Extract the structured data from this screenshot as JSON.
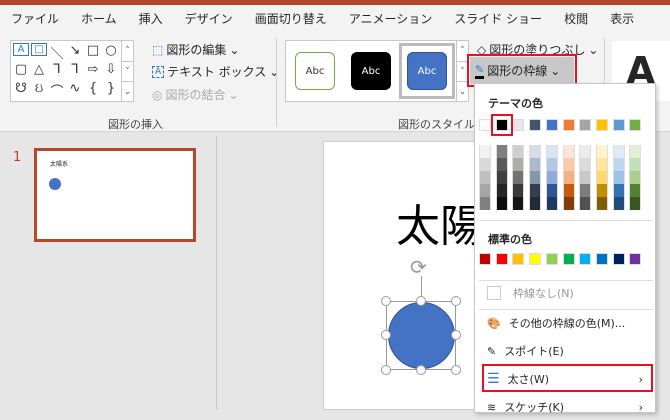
{
  "tabs": [
    "ファイル",
    "ホーム",
    "挿入",
    "デザイン",
    "画面切り替え",
    "アニメーション",
    "スライド ショー",
    "校閲",
    "表示"
  ],
  "ribbon": {
    "insert_shapes": {
      "edit_shape": "図形の編集",
      "text_box": "テキスト ボックス",
      "merge_shapes": "図形の結合",
      "group_label": "図形の挿入"
    },
    "shape_styles": {
      "styles": [
        "Abc",
        "Abc",
        "Abc"
      ],
      "fill": "図形の塗りつぶし",
      "outline": "図形の枠線",
      "group_label": "図形のスタイル"
    },
    "wordart_letter": "A"
  },
  "slides_pane": {
    "slide_number": "1",
    "thumb_title": "太陽系"
  },
  "slide": {
    "title_partial": "太陽"
  },
  "menu": {
    "theme_colors_label": "テーマの色",
    "theme_top": [
      "#ffffff",
      "#000000",
      "#e7e6e6",
      "#44546a",
      "#4472c4",
      "#ed7d31",
      "#a5a5a5",
      "#ffc000",
      "#5b9bd5",
      "#70ad47"
    ],
    "theme_shades": [
      [
        "#f2f2f2",
        "#d9d9d9",
        "#bfbfbf",
        "#a6a6a6",
        "#808080"
      ],
      [
        "#7f7f7f",
        "#595959",
        "#3f3f3f",
        "#262626",
        "#0d0d0d"
      ],
      [
        "#d0cece",
        "#aeabab",
        "#757171",
        "#3a3838",
        "#171616"
      ],
      [
        "#d6dce5",
        "#adb9ca",
        "#8497b0",
        "#333f50",
        "#222a35"
      ],
      [
        "#dae3f3",
        "#b4c7e7",
        "#8faadc",
        "#2f5597",
        "#203864"
      ],
      [
        "#fbe5d6",
        "#f8cbad",
        "#f4b183",
        "#c55a11",
        "#843c0c"
      ],
      [
        "#ededed",
        "#dbdbdb",
        "#c9c9c9",
        "#7c7c7c",
        "#525252"
      ],
      [
        "#fff2cc",
        "#ffe699",
        "#ffd966",
        "#bf9000",
        "#7f6000"
      ],
      [
        "#deebf7",
        "#bdd7ee",
        "#9dc3e6",
        "#2e75b6",
        "#1f4e79"
      ],
      [
        "#e2f0d9",
        "#c5e0b4",
        "#a9d18e",
        "#548235",
        "#385723"
      ]
    ],
    "standard_colors_label": "標準の色",
    "standard_colors": [
      "#c00000",
      "#ff0000",
      "#ffc000",
      "#ffff00",
      "#92d050",
      "#00b050",
      "#00b0f0",
      "#0070c0",
      "#002060",
      "#7030a0"
    ],
    "no_outline": "枠線なし(N)",
    "more_colors": "その他の枠線の色(M)...",
    "eyedropper": "スポイト(E)",
    "weight": "太さ(W)",
    "sketched": "スケッチ(K)",
    "selected_color": "#000000"
  },
  "colors": {
    "accent": "#b7472a",
    "highlight": "#e81123",
    "shape_fill": "#4472c4"
  }
}
